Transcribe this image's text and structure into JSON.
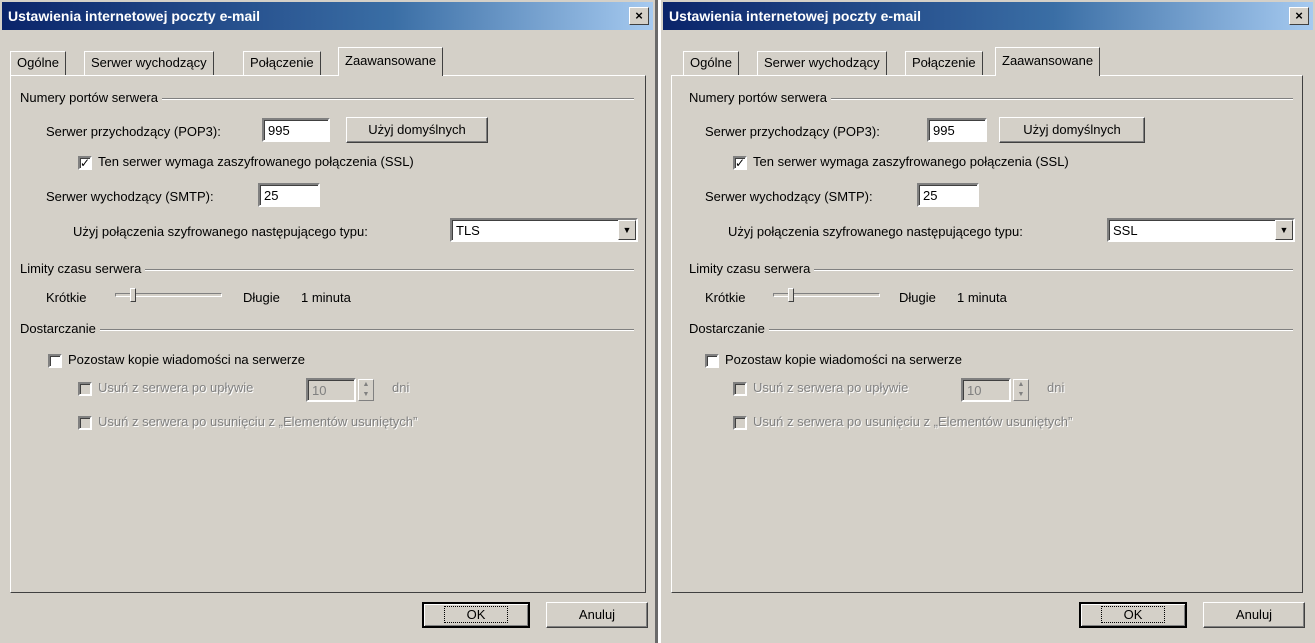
{
  "dialogs": [
    {
      "title": "Ustawienia internetowej poczty e-mail",
      "close": "×",
      "tabs": [
        "Ogólne",
        "Serwer wychodzący",
        "Połączenie",
        "Zaawansowane"
      ],
      "active_tab": "Zaawansowane",
      "ports_group": "Numery portów serwera",
      "incoming_label": "Serwer przychodzący (POP3):",
      "incoming_port": "995",
      "defaults_button": "Użyj domyślnych",
      "ssl_required_label": "Ten serwer wymaga zaszyfrowanego połączenia (SSL)",
      "ssl_required_checked": "✓",
      "outgoing_label": "Serwer wychodzący (SMTP):",
      "outgoing_port": "25",
      "encryption_label": "Użyj połączenia szyfrowanego następującego typu:",
      "encryption_value": "TLS",
      "arrow": "▼",
      "timeout_group": "Limity czasu serwera",
      "timeout_short": "Krótkie",
      "timeout_long": "Długie",
      "timeout_value": "1 minuta",
      "timeout_slider_position": 0.15,
      "delivery_group": "Dostarczanie",
      "leave_copy_label": "Pozostaw kopie wiadomości na serwerze",
      "remove_after_label": "Usuń z serwera po upływie",
      "remove_after_days": "10",
      "days_label": "dni",
      "remove_deleted_label": "Usuń z serwera po usunięciu z „Elementów usuniętych”",
      "ok": "OK",
      "cancel": "Anuluj"
    },
    {
      "title": "Ustawienia internetowej poczty e-mail",
      "close": "×",
      "tabs": [
        "Ogólne",
        "Serwer wychodzący",
        "Połączenie",
        "Zaawansowane"
      ],
      "active_tab": "Zaawansowane",
      "ports_group": "Numery portów serwera",
      "incoming_label": "Serwer przychodzący (POP3):",
      "incoming_port": "995",
      "defaults_button": "Użyj domyślnych",
      "ssl_required_label": "Ten serwer wymaga zaszyfrowanego połączenia (SSL)",
      "ssl_required_checked": "✓",
      "outgoing_label": "Serwer wychodzący (SMTP):",
      "outgoing_port": "25",
      "encryption_label": "Użyj połączenia szyfrowanego następującego typu:",
      "encryption_value": "SSL",
      "arrow": "▼",
      "timeout_group": "Limity czasu serwera",
      "timeout_short": "Krótkie",
      "timeout_long": "Długie",
      "timeout_value": "1 minuta",
      "timeout_slider_position": 0.15,
      "delivery_group": "Dostarczanie",
      "leave_copy_label": "Pozostaw kopie wiadomości na serwerze",
      "remove_after_label": "Usuń z serwera po upływie",
      "remove_after_days": "10",
      "days_label": "dni",
      "remove_deleted_label": "Usuń z serwera po usunięciu z „Elementów usuniętych”",
      "ok": "OK",
      "cancel": "Anuluj"
    }
  ]
}
